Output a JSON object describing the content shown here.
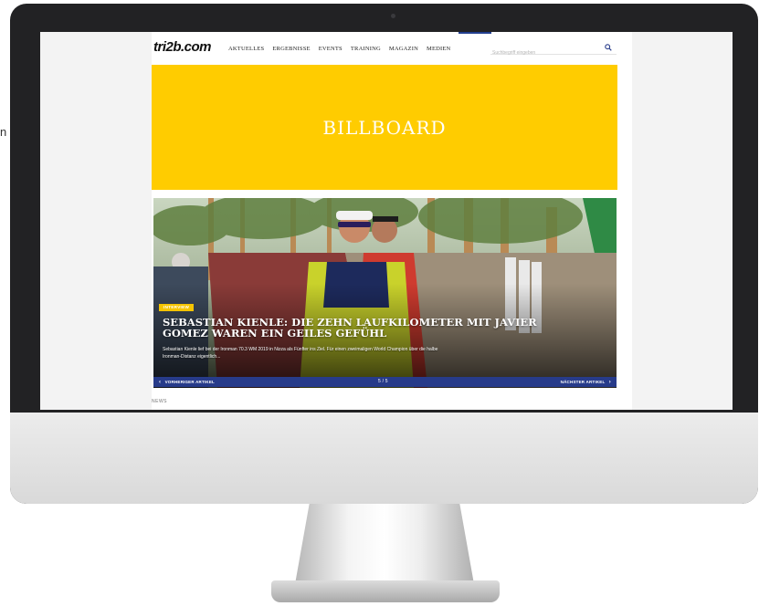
{
  "outside_text": "n",
  "site": {
    "logo": "tri2b.com",
    "nav": [
      "AKTUELLES",
      "ERGEBNISSE",
      "EVENTS",
      "TRAINING",
      "MAGAZIN",
      "MEDIEN"
    ],
    "search_placeholder": "Suchbegriff eingeben"
  },
  "billboard": {
    "label": "BILLBOARD"
  },
  "hero": {
    "badge": "INTERVIEW",
    "headline": "SEBASTIAN KIENLE: DIE ZEHN LAUFKILOMETER MIT JAVIER GOMEZ WAREN EIN GEILES GEFÜHL",
    "teaser": "Sebastian Kienle lief bei der Ironman 70.3 WM 2019 in Nizza als Fünfter ins Ziel. Für einen zweimaligen World Champion über die halbe Ironman-Distanz eigentlich...",
    "prev_label": "VORHERIGER ARTIKEL",
    "next_label": "NÄCHSTER ARTIKEL",
    "counter": "5 / 5"
  },
  "section_label": "NEWS",
  "colors": {
    "billboard": "#ffcc00",
    "slider_bar": "#273b8a",
    "badge": "#f5c400"
  }
}
